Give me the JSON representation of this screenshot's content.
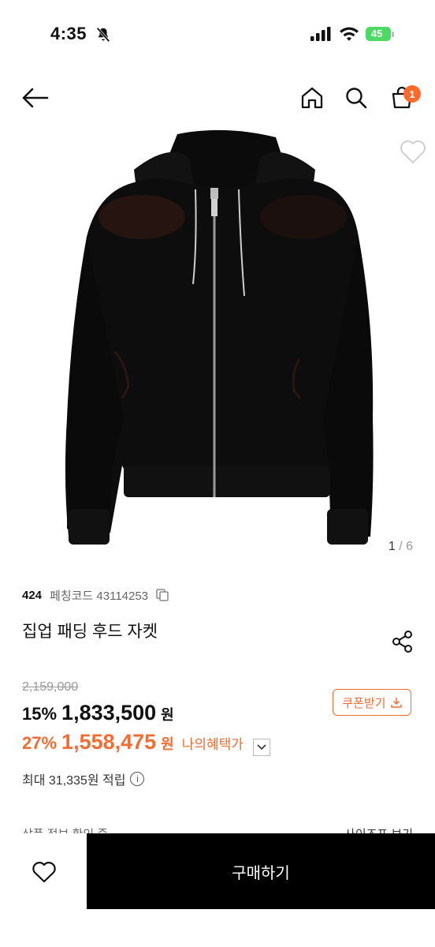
{
  "status_bar": {
    "time": "4:35",
    "battery": "45"
  },
  "nav": {
    "cart_count": "1"
  },
  "gallery": {
    "current": "1",
    "separator": " / ",
    "total": "6"
  },
  "product": {
    "brand": "424",
    "code": "페칭코드 43114253",
    "title": "집업 패딩 후드 자켓"
  },
  "pricing": {
    "original": "2,159,000",
    "discount_rate": "15%",
    "price": "1,833,500",
    "currency": "원",
    "coupon_label": "쿠폰받기",
    "my_rate": "27%",
    "my_price": "1,558,475",
    "my_currency": "원",
    "my_label": "나의혜택가"
  },
  "points": {
    "text": "최대 31,335원 적립"
  },
  "partial": {
    "left": "상품 정보 확인 중",
    "right": "사이즈표 보기"
  },
  "bottom": {
    "buy_label": "구매하기"
  },
  "colors": {
    "accent": "#f36c32",
    "cart_badge": "#ff6a2b",
    "buy_button": "#000000"
  }
}
